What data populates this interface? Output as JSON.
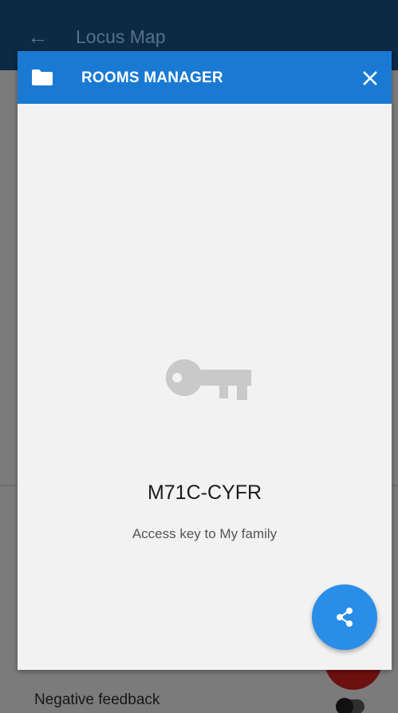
{
  "app_bar": {
    "title": "Locus Map",
    "back_icon": "arrow-left-icon"
  },
  "dialog": {
    "title": "ROOMS MANAGER",
    "header_icon": "folder-icon",
    "close_icon": "close-icon",
    "header_color": "#1a7ad3"
  },
  "access": {
    "icon": "key-icon",
    "code": "M71C-CYFR",
    "description": "Access key to My family"
  },
  "share_button": {
    "icon": "share-icon",
    "color": "#2a8de8"
  },
  "background": {
    "setting_label": "Negative feedback",
    "toggle_state": "off"
  }
}
